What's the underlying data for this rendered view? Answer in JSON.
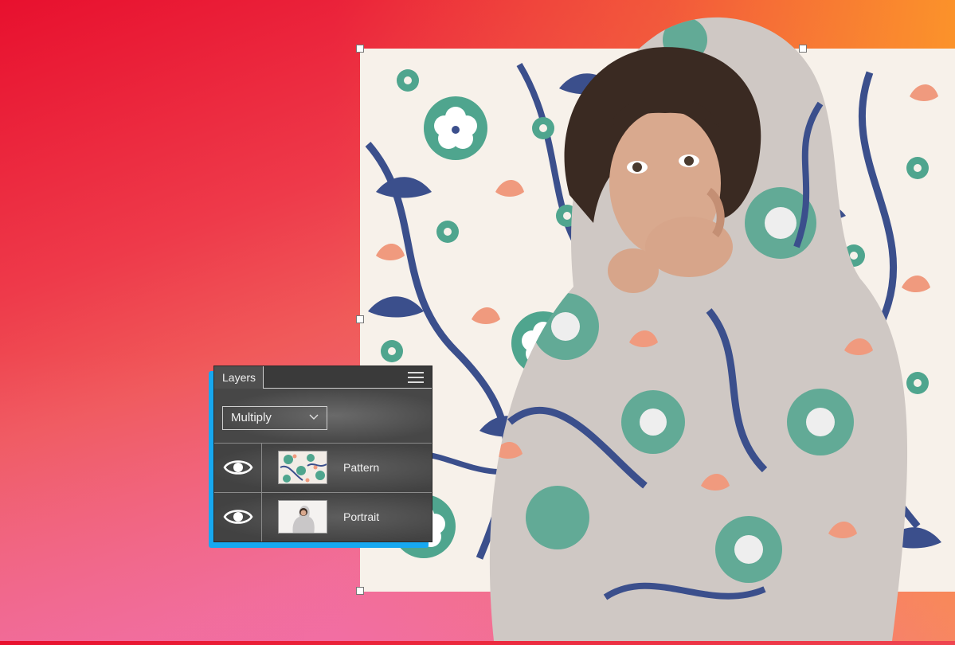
{
  "layers_panel": {
    "tab_label": "Layers",
    "blend_mode": "Multiply",
    "layers": [
      {
        "name": "Pattern",
        "visible": true,
        "thumbnail": "pattern-thumbnail"
      },
      {
        "name": "Portrait",
        "visible": true,
        "thumbnail": "portrait-thumbnail"
      }
    ]
  },
  "colors": {
    "accent_blue": "#17a8f0",
    "panel_bg": "#4a4a4a",
    "pattern_green": "#4fa58e",
    "pattern_navy": "#3b4f8c",
    "pattern_coral": "#f09a7e"
  }
}
